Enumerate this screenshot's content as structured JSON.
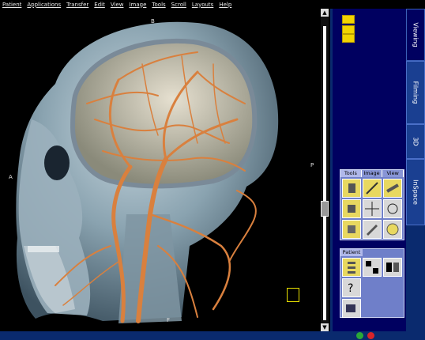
{
  "menubar": {
    "items": [
      "Patient",
      "Applications",
      "Transfer",
      "Edit",
      "View",
      "Image",
      "Tools",
      "Scroll",
      "Layouts",
      "Help"
    ]
  },
  "viewport": {
    "orient_top": "B",
    "orient_left": "A",
    "orient_right": "P",
    "orient_bottom": "F"
  },
  "sidebar": {
    "tabs": [
      "Viewing",
      "Filming",
      "3D",
      "InSpace"
    ],
    "active_tab": "Viewing"
  },
  "tools_panel": {
    "tabs": [
      "Tools",
      "Image",
      "View"
    ]
  },
  "patient_panel": {
    "title": "Patient"
  },
  "colors": {
    "panel_bg": "#0a2a6e",
    "tab_active": "#000060",
    "tool_yellow": "#e8d860"
  }
}
